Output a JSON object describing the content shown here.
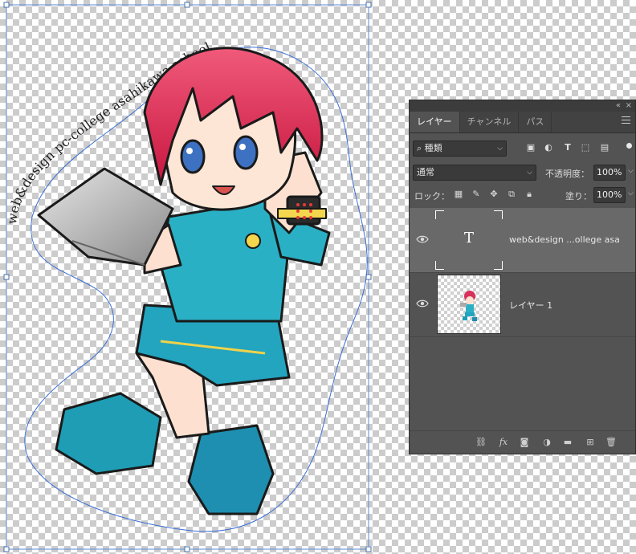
{
  "canvas": {
    "path_text": "web&design pc-college asahikawa school"
  },
  "layers_panel": {
    "tabs": [
      {
        "label": "レイヤー",
        "active": true
      },
      {
        "label": "チャンネル",
        "active": false
      },
      {
        "label": "パス",
        "active": false
      }
    ],
    "filter": {
      "kind_label": "種類"
    },
    "blend_mode": "通常",
    "opacity_label": "不透明度：",
    "opacity_value": "100%",
    "lock_label": "ロック：",
    "fill_label": "塗り：",
    "fill_value": "100%",
    "layers": [
      {
        "name": "web&design ...ollege asa",
        "type": "text",
        "thumb_glyph": "T",
        "selected": true,
        "visible": true
      },
      {
        "name": "レイヤー 1",
        "type": "pixel",
        "selected": false,
        "visible": true
      }
    ],
    "footer_icons": [
      "link-icon",
      "fx-icon",
      "mask-icon",
      "adjustment-icon",
      "folder-icon",
      "new-layer-icon",
      "trash-icon"
    ],
    "fx_label": "fx"
  },
  "colors": {
    "panel_bg": "#535353",
    "selected_row": "#696969",
    "path_stroke": "#3b6fd6"
  }
}
